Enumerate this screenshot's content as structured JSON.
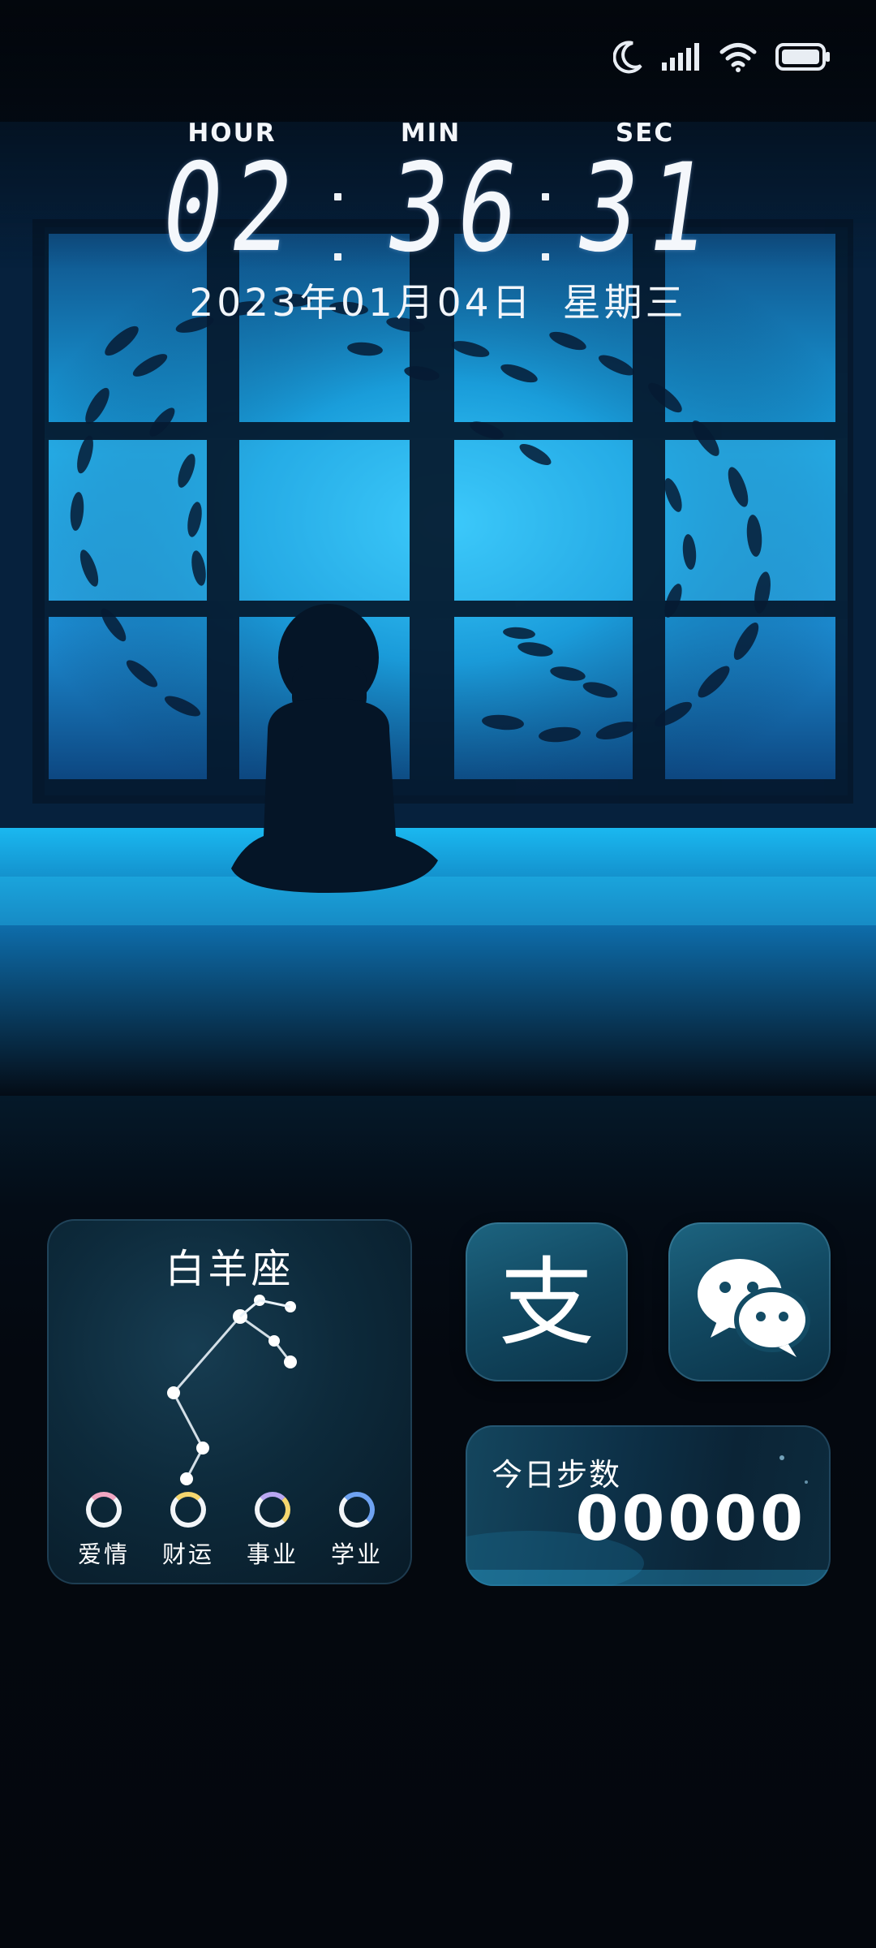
{
  "status_bar": {
    "icons": [
      "moon-icon",
      "signal-icon",
      "wifi-icon",
      "battery-icon"
    ]
  },
  "clock": {
    "hour_label": "HOUR",
    "min_label": "MIN",
    "sec_label": "SEC",
    "hour": "02",
    "min": "36",
    "sec": "31"
  },
  "date": {
    "date_text": "2023年01月04日",
    "weekday": "星期三"
  },
  "zodiac_widget": {
    "title": "白羊座",
    "categories": [
      {
        "label": "爱情",
        "accent": "#f2a7c3"
      },
      {
        "label": "财运",
        "accent": "#f5d76e"
      },
      {
        "label": "事业",
        "accent": "#b9a7f2"
      },
      {
        "label": "学业",
        "accent": "#6fa3f2"
      }
    ]
  },
  "apps": [
    {
      "icon": "alipay-icon",
      "glyph": "支"
    },
    {
      "icon": "wechat-icon"
    }
  ],
  "steps_widget": {
    "label": "今日步数",
    "count": "00000"
  },
  "colors": {
    "accent_blue": "#1fb0e8",
    "tile_teal": "#124a63"
  }
}
